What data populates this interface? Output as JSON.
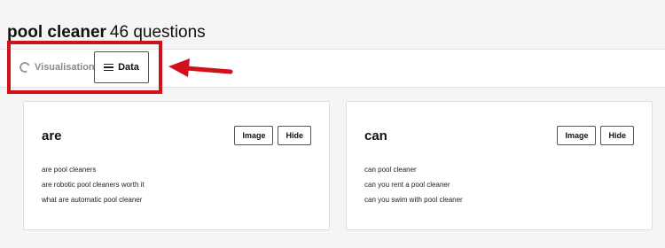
{
  "header": {
    "keyword": "pool cleaner",
    "count_text": "46 questions"
  },
  "tabs": [
    {
      "label": "Visualisation",
      "icon": "spinner-icon",
      "active": false
    },
    {
      "label": "Data",
      "icon": "list-icon",
      "active": true
    }
  ],
  "annotation": {
    "color": "#d0111b",
    "arrow_icon": "left-arrow-icon"
  },
  "cards": [
    {
      "title": "are",
      "image_label": "Image",
      "hide_label": "Hide",
      "questions": [
        "are pool cleaners",
        "are robotic pool cleaners worth it",
        "what are automatic pool cleaner"
      ]
    },
    {
      "title": "can",
      "image_label": "Image",
      "hide_label": "Hide",
      "questions": [
        "can pool cleaner",
        "can you rent a pool cleaner",
        "can you swim with pool cleaner"
      ]
    }
  ]
}
